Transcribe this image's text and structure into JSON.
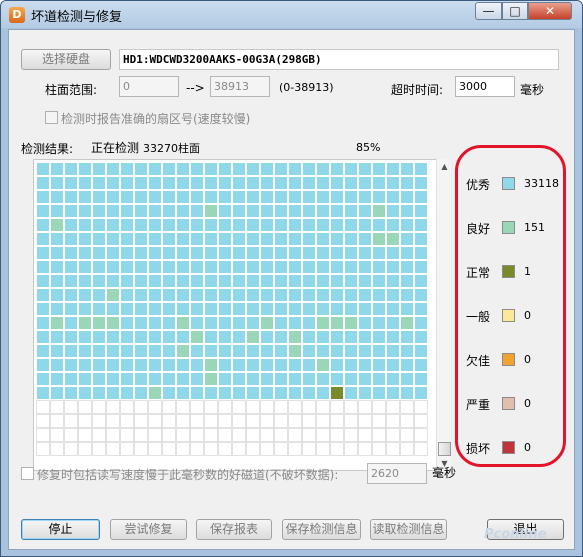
{
  "window": {
    "title": "坏道检测与修复",
    "app_icon_glyph": "D",
    "minimize_glyph": "—",
    "maximize_glyph": "□",
    "close_glyph": "✕"
  },
  "disk": {
    "select_button": "选择硬盘",
    "name": "HD1:WDCWD3200AAKS-00G3A(298GB)"
  },
  "range": {
    "label": "柱面范围:",
    "from_value": "0",
    "arrow": "-->",
    "to_value": "38913",
    "hint": "(0-38913)"
  },
  "timeout": {
    "label": "超时时间:",
    "value": "3000",
    "unit": "毫秒"
  },
  "report_option": {
    "label": "检测时报告准确的扇区号(速度较慢)"
  },
  "status": {
    "label": "检测结果:",
    "text": "正在检测",
    "cylinder": "33270柱面",
    "percent": "85%"
  },
  "grid": {
    "columns": 28,
    "rows": 21,
    "filled_cells": 476,
    "good_cells": [
      [
        3,
        12
      ],
      [
        3,
        24
      ],
      [
        4,
        1
      ],
      [
        5,
        24
      ],
      [
        5,
        25
      ],
      [
        9,
        5
      ],
      [
        11,
        1
      ],
      [
        11,
        3
      ],
      [
        11,
        4
      ],
      [
        11,
        5
      ],
      [
        11,
        10
      ],
      [
        11,
        16
      ],
      [
        11,
        20
      ],
      [
        11,
        21
      ],
      [
        11,
        22
      ],
      [
        11,
        26
      ],
      [
        12,
        11
      ],
      [
        12,
        15
      ],
      [
        12,
        18
      ],
      [
        13,
        10
      ],
      [
        13,
        18
      ],
      [
        14,
        12
      ],
      [
        14,
        20
      ],
      [
        15,
        12
      ],
      [
        16,
        8
      ],
      [
        17,
        1
      ],
      [
        17,
        3
      ],
      [
        17,
        4
      ]
    ],
    "normal_cells": [
      [
        16,
        21
      ]
    ],
    "colors": {
      "excellent": "#8fd8ea",
      "good": "#9ad7b8",
      "normal": "#7a8a2a",
      "empty": "#ffffff"
    }
  },
  "legend": [
    {
      "label": "优秀",
      "count": "33118",
      "color": "#8fd8ea"
    },
    {
      "label": "良好",
      "count": "151",
      "color": "#9ad7b8"
    },
    {
      "label": "正常",
      "count": "1",
      "color": "#7a8a2a"
    },
    {
      "label": "一般",
      "count": "0",
      "color": "#fbe89a"
    },
    {
      "label": "欠佳",
      "count": "0",
      "color": "#f0a430"
    },
    {
      "label": "严重",
      "count": "0",
      "color": "#e0bfae"
    },
    {
      "label": "损坏",
      "count": "0",
      "color": "#c0343c"
    }
  ],
  "repair_option": {
    "label": "修复时包括读写速度慢于此毫秒数的好磁道(不破坏数据):",
    "value": "2620",
    "unit": "毫秒"
  },
  "buttons": {
    "stop": "停止",
    "try_repair": "尝试修复",
    "save_report": "保存报表",
    "save_info": "保存检测信息",
    "load_info": "读取检测信息",
    "exit": "退出"
  },
  "watermark": "Pconline"
}
